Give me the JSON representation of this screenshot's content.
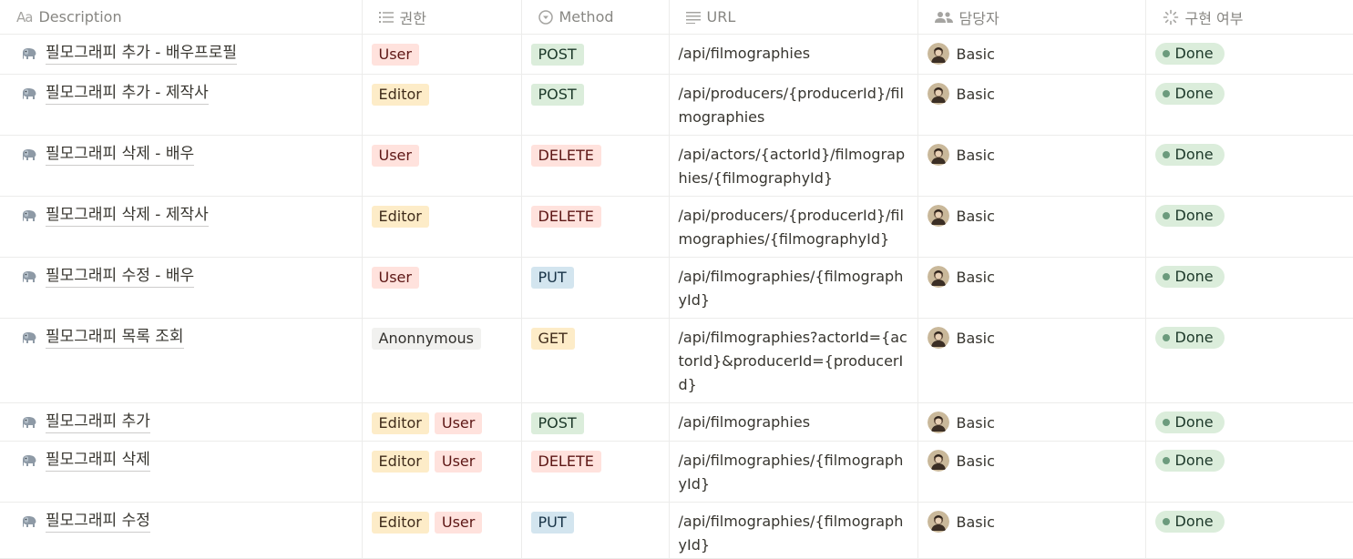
{
  "headers": {
    "description": "Description",
    "permission": "권한",
    "method": "Method",
    "url": "URL",
    "assignee": "담당자",
    "status": "구현 여부"
  },
  "tag_colors": {
    "User": {
      "bg": "#ffe2dd",
      "fg": "#5d1715"
    },
    "Editor": {
      "bg": "#fdecc8",
      "fg": "#402c1b"
    },
    "Anonnymous": {
      "bg": "#f1f1ef",
      "fg": "#32302c"
    },
    "POST": {
      "bg": "#dbeddb",
      "fg": "#1c3829"
    },
    "DELETE": {
      "bg": "#ffe2dd",
      "fg": "#5d1715"
    },
    "PUT": {
      "bg": "#d3e5ef",
      "fg": "#183347"
    },
    "GET": {
      "bg": "#fdecc8",
      "fg": "#402c1b"
    }
  },
  "status_colors": {
    "bg": "#dbeddb",
    "fg": "#1c3829",
    "dot": "#6c9b7d"
  },
  "rows": [
    {
      "title": "필모그래피 추가 - 배우프로필",
      "permissions": [
        "User"
      ],
      "method": "POST",
      "url": "/api/filmographies",
      "assignee": "Basic",
      "status": "Done"
    },
    {
      "title": "필모그래피 추가 - 제작사",
      "permissions": [
        "Editor"
      ],
      "method": "POST",
      "url": "/api/producers/{producerId}/filmographies",
      "assignee": "Basic",
      "status": "Done"
    },
    {
      "title": "필모그래피 삭제 - 배우",
      "permissions": [
        "User"
      ],
      "method": "DELETE",
      "url": "/api/actors/{actorId}/filmographies/{filmographyId}",
      "assignee": "Basic",
      "status": "Done"
    },
    {
      "title": "필모그래피 삭제 - 제작사",
      "permissions": [
        "Editor"
      ],
      "method": "DELETE",
      "url": "/api/producers/{producerId}/filmographies/{filmographyId}",
      "assignee": "Basic",
      "status": "Done"
    },
    {
      "title": "필모그래피 수정 - 배우",
      "permissions": [
        "User"
      ],
      "method": "PUT",
      "url": "/api/filmographies/{filmographyId}",
      "assignee": "Basic",
      "status": "Done"
    },
    {
      "title": "필모그래피 목록 조회",
      "permissions": [
        "Anonnymous"
      ],
      "method": "GET",
      "url": "/api/filmographies?actorId={actorId}&producerId={producerId}",
      "assignee": "Basic",
      "status": "Done"
    },
    {
      "title": "필모그래피 추가",
      "permissions": [
        "Editor",
        "User"
      ],
      "method": "POST",
      "url": "/api/filmographies",
      "assignee": "Basic",
      "status": "Done"
    },
    {
      "title": "필모그래피 삭제",
      "permissions": [
        "Editor",
        "User"
      ],
      "method": "DELETE",
      "url": "/api/filmographies/{filmographyId}",
      "assignee": "Basic",
      "status": "Done"
    },
    {
      "title": "필모그래피 수정",
      "permissions": [
        "Editor",
        "User"
      ],
      "method": "PUT",
      "url": "/api/filmographies/{filmographyId}",
      "assignee": "Basic",
      "status": "Done"
    }
  ]
}
